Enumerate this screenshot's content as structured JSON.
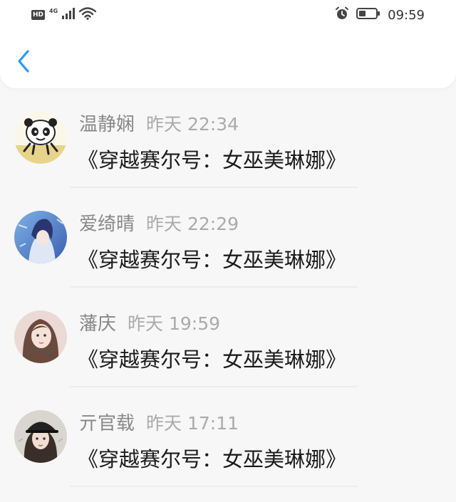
{
  "status_bar": {
    "hd": "HD",
    "network": "4G",
    "time": "09:59",
    "icons": [
      "hd-icon",
      "signal-icon",
      "wifi-icon",
      "alarm-icon",
      "battery-icon"
    ]
  },
  "nav": {
    "back_icon": "chevron-left-icon",
    "accent_color": "#2a9af3"
  },
  "comments": [
    {
      "name": "温静娴",
      "time": "昨天 22:34",
      "message": "《穿越赛尔号：女巫美琳娜》",
      "avatar": "panda-avatar"
    },
    {
      "name": "爱绮晴",
      "time": "昨天 22:29",
      "message": "《穿越赛尔号：女巫美琳娜》",
      "avatar": "anime-avatar"
    },
    {
      "name": "藩庆",
      "time": "昨天 19:59",
      "message": "《穿越赛尔号：女巫美琳娜》",
      "avatar": "girl-avatar"
    },
    {
      "name": "亓官载",
      "time": "昨天 17:11",
      "message": "《穿越赛尔号：女巫美琳娜》",
      "avatar": "cap-girl-avatar"
    }
  ]
}
